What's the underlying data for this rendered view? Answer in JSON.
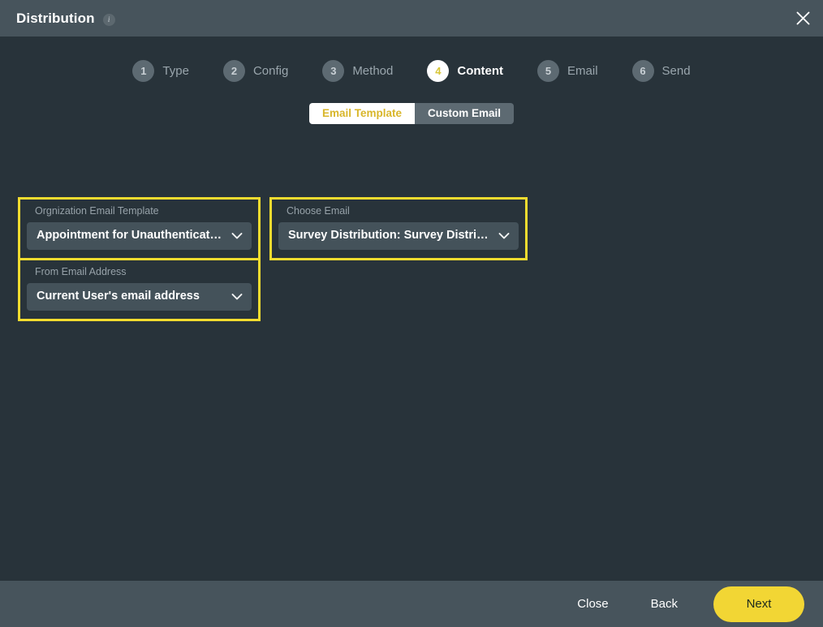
{
  "window": {
    "title": "Distribution",
    "info_icon": "info-icon",
    "info_glyph": "i",
    "close_icon": "close-icon"
  },
  "stepper": {
    "steps": [
      {
        "number": "1",
        "label": "Type",
        "active": false
      },
      {
        "number": "2",
        "label": "Config",
        "active": false
      },
      {
        "number": "3",
        "label": "Method",
        "active": false
      },
      {
        "number": "4",
        "label": "Content",
        "active": true
      },
      {
        "number": "5",
        "label": "Email",
        "active": false
      },
      {
        "number": "6",
        "label": "Send",
        "active": false
      }
    ]
  },
  "toggle": {
    "selected": "Email Template",
    "options": [
      {
        "label": "Email Template",
        "selected": true
      },
      {
        "label": "Custom Email",
        "selected": false
      }
    ]
  },
  "fields": {
    "org_template": {
      "label": "Orgnization Email Template",
      "value": "Appointment for Unauthenticate...",
      "chevron": "chevron-down-icon",
      "highlighted": true
    },
    "choose_email": {
      "label": "Choose Email",
      "value": "Survey Distribution: Survey Distrib...",
      "chevron": "chevron-down-icon",
      "highlighted": true
    },
    "from_email": {
      "label": "From Email Address",
      "value": "Current User's email address",
      "chevron": "chevron-down-icon",
      "highlighted": true
    }
  },
  "footer": {
    "close_label": "Close",
    "back_label": "Back",
    "next_label": "Next"
  },
  "colors": {
    "accent_yellow": "#f2d634",
    "highlight_border": "#f2dc2f",
    "body_bg": "#28333a",
    "bar_bg": "#47545c",
    "select_bg": "#44525a",
    "step_inactive": "#5d6a72"
  }
}
